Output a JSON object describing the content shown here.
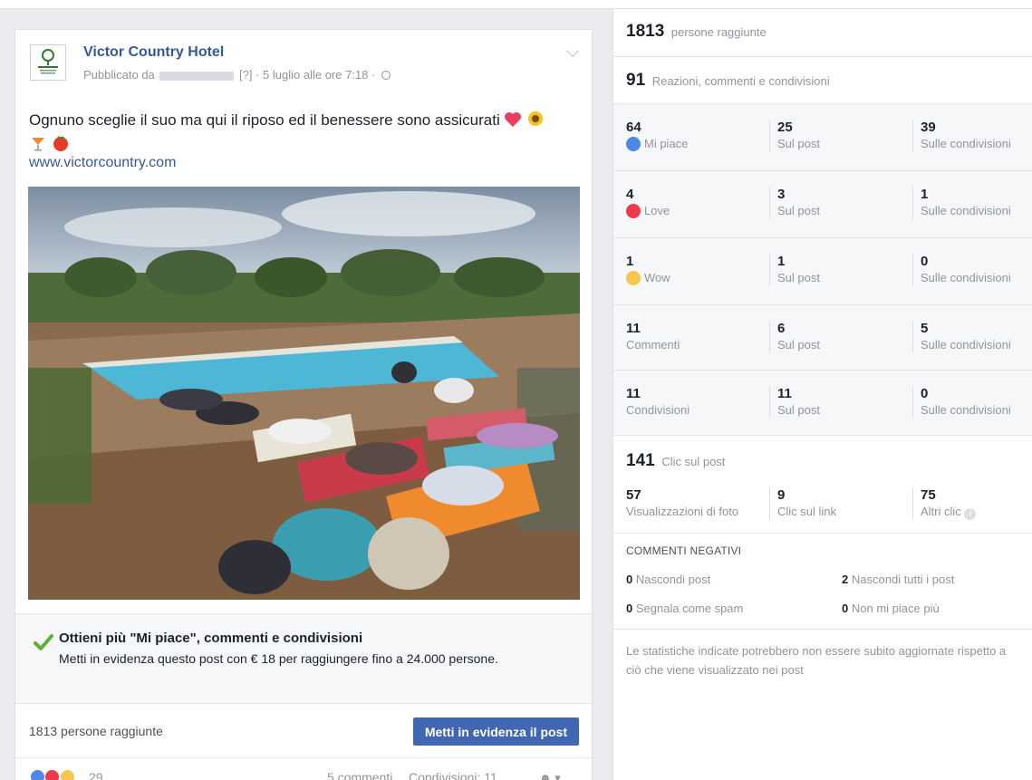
{
  "post": {
    "page_name": "Victor Country Hotel",
    "meta_prefix": "Pubblicato da",
    "meta_suffix": "[?] · 5 luglio alle ore 7:18 ·",
    "text": "Ognuno sceglie il suo ma qui il riposo ed il benessere sono assicurati",
    "link": "www.victorcountry.com",
    "photo_icon": "pool-yoga-photo",
    "boost": {
      "title": "Ottieni più \"Mi piace\", commenti e condivisioni",
      "description": "Metti in evidenza questo post con € 18 per raggiungere fino a 24.000 persone."
    },
    "reach_text": "1813 persone raggiunte",
    "boost_button": "Metti in evidenza il post",
    "reaction_count": "29",
    "comments": "5 commenti",
    "shares": "Condivisioni: 11"
  },
  "stats": {
    "reach": {
      "value": "1813",
      "label": "persone raggiunte"
    },
    "engagement": {
      "value": "91",
      "label": "Reazioni, commenti e condivisioni"
    },
    "rows": [
      {
        "total": "64",
        "label": "Mi piace",
        "icon": "like-icon",
        "on_post": "25",
        "on_post_label": "Sul post",
        "on_shares": "39",
        "on_shares_label": "Sulle condivisioni"
      },
      {
        "total": "4",
        "label": "Love",
        "icon": "love-icon",
        "on_post": "3",
        "on_post_label": "Sul post",
        "on_shares": "1",
        "on_shares_label": "Sulle condivisioni"
      },
      {
        "total": "1",
        "label": "Wow",
        "icon": "wow-icon",
        "on_post": "1",
        "on_post_label": "Sul post",
        "on_shares": "0",
        "on_shares_label": "Sulle condivisioni"
      },
      {
        "total": "11",
        "label": "Commenti",
        "on_post": "6",
        "on_post_label": "Sul post",
        "on_shares": "5",
        "on_shares_label": "Sulle condivisioni"
      },
      {
        "total": "11",
        "label": "Condivisioni",
        "on_post": "11",
        "on_post_label": "Sul post",
        "on_shares": "0",
        "on_shares_label": "Sulle condivisioni"
      }
    ],
    "clicks": {
      "value": "141",
      "label": "Clic sul post",
      "photo_views": "57",
      "photo_views_label": "Visualizzazioni di foto",
      "link_clicks": "9",
      "link_clicks_label": "Clic sul link",
      "other_clicks": "75",
      "other_clicks_label": "Altri clic"
    },
    "negative": {
      "title": "COMMENTI NEGATIVI",
      "hide_post": "0",
      "hide_post_label": "Nascondi post",
      "hide_all": "2",
      "hide_all_label": "Nascondi tutti i post",
      "spam": "0",
      "spam_label": "Segnala come spam",
      "unlike": "0",
      "unlike_label": "Non mi piace più"
    },
    "note": "Le statistiche indicate potrebbero non essere subito aggiornate rispetto a ciò che viene visualizzato nei post"
  }
}
